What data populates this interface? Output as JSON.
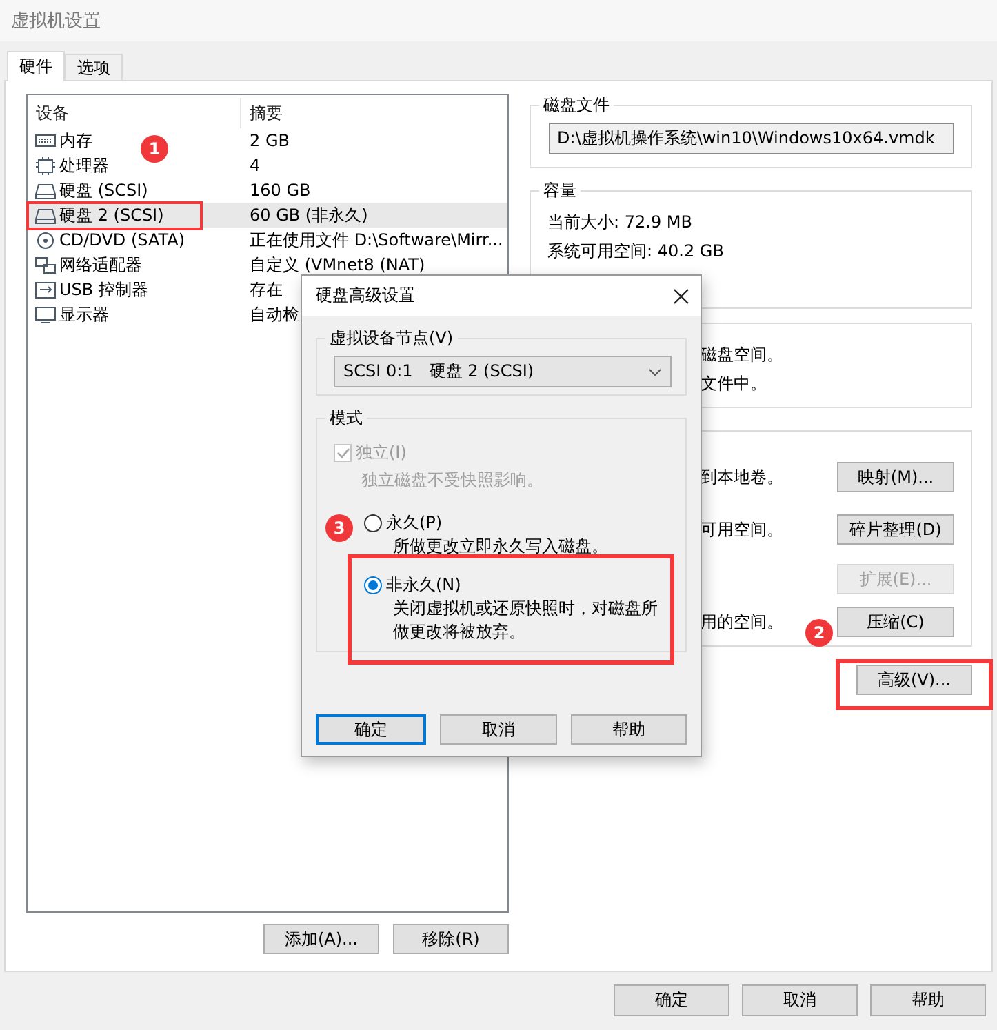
{
  "window": {
    "title": "虚拟机设置"
  },
  "tabs": [
    {
      "label": "硬件",
      "selected": true
    },
    {
      "label": "选项",
      "selected": false
    }
  ],
  "device_table": {
    "columns": [
      "设备",
      "摘要"
    ],
    "rows": [
      {
        "kind": "memory",
        "device": "内存",
        "summary": "2 GB",
        "selected": false
      },
      {
        "kind": "cpu",
        "device": "处理器",
        "summary": "4",
        "selected": false
      },
      {
        "kind": "disk",
        "device": "硬盘 (SCSI)",
        "summary": "160 GB",
        "selected": false
      },
      {
        "kind": "disk",
        "device": "硬盘 2 (SCSI)",
        "summary": "60 GB (非永久)",
        "selected": true
      },
      {
        "kind": "cdrom",
        "device": "CD/DVD (SATA)",
        "summary": "正在使用文件 D:\\Software\\Mirr...",
        "selected": false
      },
      {
        "kind": "network",
        "device": "网络适配器",
        "summary": "自定义 (VMnet8 (NAT)",
        "selected": false
      },
      {
        "kind": "usb",
        "device": "USB 控制器",
        "summary": "存在",
        "selected": false
      },
      {
        "kind": "display",
        "device": "显示器",
        "summary": "自动检",
        "selected": false
      }
    ]
  },
  "device_buttons": [
    "添加(A)...",
    "移除(R)"
  ],
  "disk_file": {
    "title": "磁盘文件",
    "path": "D:\\虚拟机操作系统\\win10\\Windows10x64.vmdk"
  },
  "capacity": {
    "title": "容量",
    "lines": [
      "当前大小: 72.9 MB",
      "系统可用空间: 40.2 GB"
    ]
  },
  "allocation": {
    "lines": [
      "磁盘空间。",
      "文件中。"
    ]
  },
  "utilities": [
    {
      "text": "到本地卷。",
      "button": "映射(M)...",
      "disabled": false
    },
    {
      "text": "可用空间。",
      "button": "碎片整理(D)",
      "disabled": false
    },
    {
      "button": "扩展(E)...",
      "disabled": true
    },
    {
      "text": "用的空间。",
      "button": "压缩(C)",
      "disabled": false
    }
  ],
  "advanced_button": "高级(V)...",
  "buttons": [
    "确定",
    "取消",
    "帮助"
  ],
  "dialog": {
    "title": "硬盘高级设置",
    "node_group": "虚拟设备节点(V)",
    "node_value": "SCSI 0:1　硬盘 2 (SCSI)",
    "mode_title": "模式",
    "independent": {
      "label": "独立(I)",
      "checked": true,
      "disabled": true,
      "note": "独立磁盘不受快照影响。"
    },
    "options": [
      {
        "label": "永久(P)",
        "description": "所做更改立即永久写入磁盘。",
        "selected": false
      },
      {
        "label": "非永久(N)",
        "description": "关闭虚拟机或还原快照时，对磁盘所做更改将被放弃。",
        "selected": true
      }
    ],
    "buttons": [
      {
        "label": "确定",
        "default": true
      },
      {
        "label": "取消",
        "default": false
      },
      {
        "label": "帮助",
        "default": false
      }
    ]
  },
  "annotations": [
    {
      "number": "1"
    },
    {
      "number": "2"
    },
    {
      "number": "3"
    }
  ]
}
